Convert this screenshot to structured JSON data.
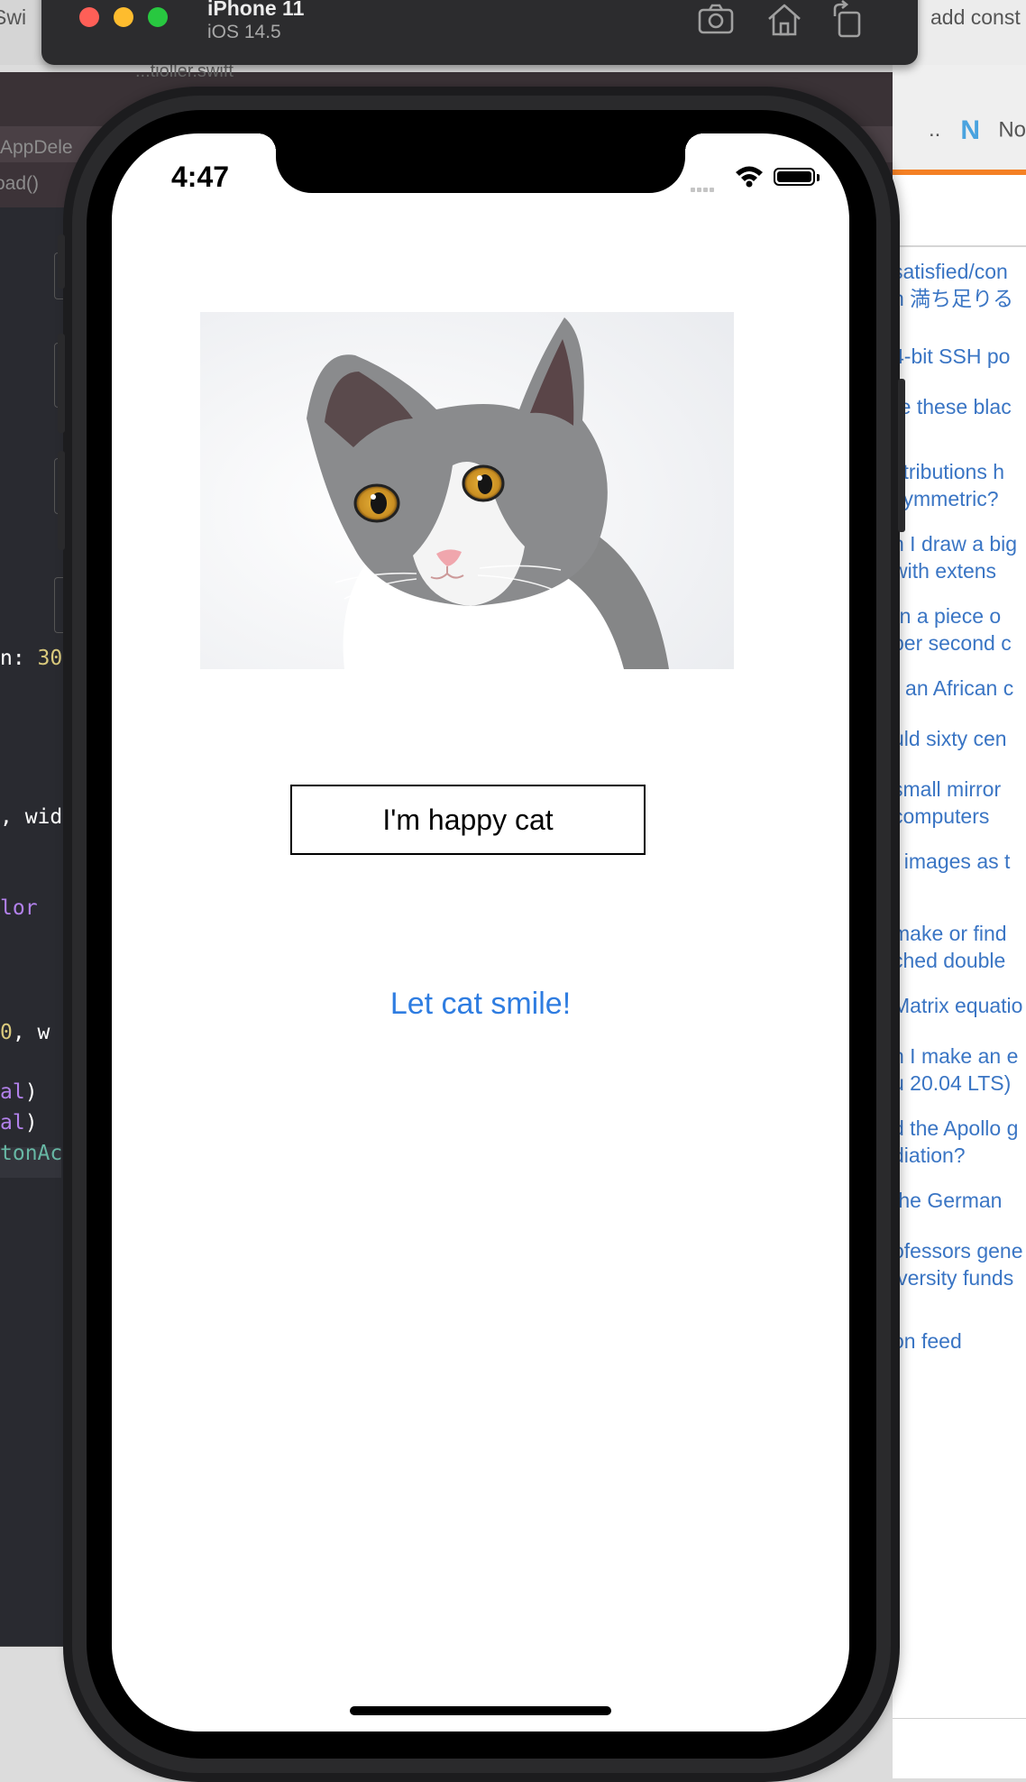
{
  "background_window_left": {
    "title_fragment": "Swi"
  },
  "xcode": {
    "file_subtitle": "...tioller.swift",
    "tab_fragment": "AppDele",
    "jump_bar_fragment": "oad()",
    "code_fragments": [
      {
        "text": "n: ",
        "num": "30"
      },
      {
        "text": ", wid"
      },
      {
        "text": "lor"
      },
      {
        "text": "0",
        "rest": ", w"
      },
      {
        "text": "al",
        "rest": ")"
      },
      {
        "text": "al",
        "rest": ")"
      },
      {
        "text": "tonAc"
      }
    ]
  },
  "browser": {
    "top_text": "add const",
    "tab_label": "Novo",
    "tab_prefix": "..",
    "links": [
      "satisfied/con",
      "n 満ち足りる",
      "4-bit SSH po",
      "re these blac",
      "stributions h",
      "symmetric?",
      "n I draw a big",
      "with extens",
      "rn a piece o",
      "per second c",
      "r an African c",
      "uld sixty cen",
      "small mirror",
      "computers",
      "t images as t",
      "make or find",
      "ched double",
      "Matrix equatio",
      "n I make an e",
      "u 20.04 LTS)",
      "d the Apollo g",
      "diation?",
      "the German",
      "ofessors gene",
      "iversity funds",
      "on feed"
    ]
  },
  "simulator": {
    "device_name": "iPhone 11",
    "os_version": "iOS 14.5",
    "toolbar_icons": [
      "screenshot-icon",
      "home-icon",
      "rotate-icon"
    ]
  },
  "app": {
    "status_time": "4:47",
    "label_text": "I'm happy cat",
    "button_title": "Let cat smile!",
    "button_color": "#2f7de1"
  }
}
